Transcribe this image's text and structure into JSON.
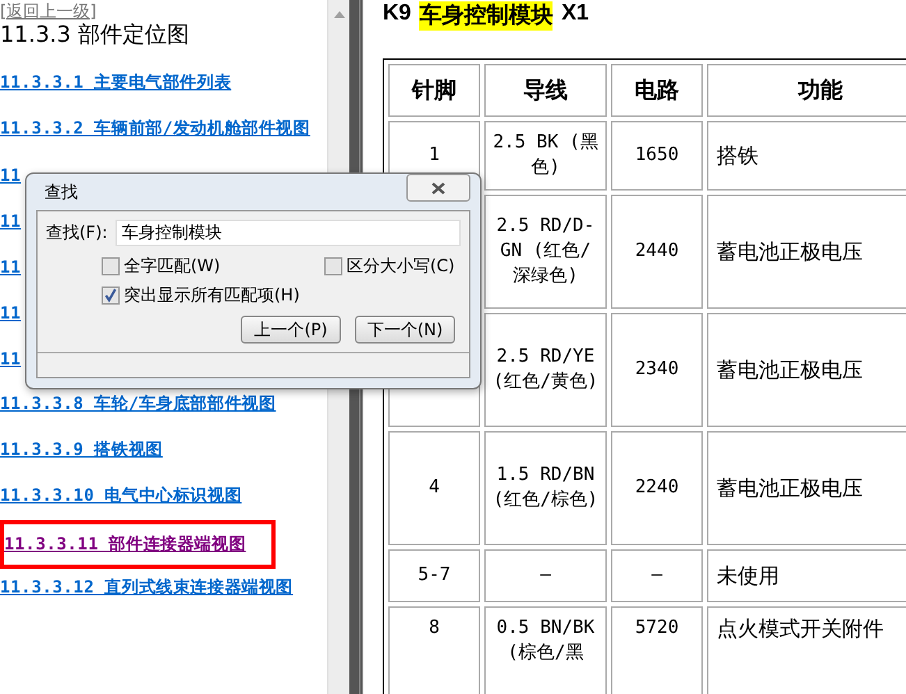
{
  "nav": {
    "back_link": "[返回上一级]",
    "heading": "11.3.3 部件定位图",
    "links": [
      {
        "text": "11.3.3.1 主要电气部件列表",
        "visited": false,
        "highlighted": false
      },
      {
        "text": "11.3.3.2 车辆前部/发动机舱部件视图",
        "visited": false,
        "highlighted": false
      },
      {
        "text": "11",
        "visited": false,
        "highlighted": false
      },
      {
        "text": "11",
        "visited": false,
        "highlighted": false
      },
      {
        "text": "11",
        "visited": false,
        "highlighted": false
      },
      {
        "text": "11",
        "visited": false,
        "highlighted": false
      },
      {
        "text": "11",
        "visited": false,
        "highlighted": false
      },
      {
        "text": "11.3.3.8 车轮/车身底部部件视图",
        "visited": false,
        "highlighted": false
      },
      {
        "text": "11.3.3.9 搭铁视图",
        "visited": false,
        "highlighted": false
      },
      {
        "text": "11.3.3.10 电气中心标识视图",
        "visited": false,
        "highlighted": false
      },
      {
        "text": "11.3.3.11 部件连接器端视图",
        "visited": true,
        "highlighted": true
      },
      {
        "text": "11.3.3.12 直列式线束连接器端视图",
        "visited": false,
        "highlighted": false
      }
    ]
  },
  "content": {
    "title_prefix": "K9",
    "title_match": "车身控制模块",
    "title_suffix": "X1",
    "table": {
      "columns": [
        "针脚",
        "导线",
        "电路",
        "功能"
      ],
      "rows": [
        {
          "pin": "1",
          "wire": "2.5 BK (黑色)",
          "circuit": "1650",
          "function": "搭铁"
        },
        {
          "wire": "2.5 RD/D-GN (红色/深绿色)",
          "circuit": "2440",
          "function": "蓄电池正极电压"
        },
        {
          "wire": "2.5 RD/YE (红色/黄色)",
          "circuit": "2340",
          "function": "蓄电池正极电压"
        },
        {
          "pin": "4",
          "wire": "1.5 RD/BN (红色/棕色)",
          "circuit": "2240",
          "function": "蓄电池正极电压"
        },
        {
          "pin": "5-7",
          "wire": "—",
          "circuit": "—",
          "function": "未使用"
        },
        {
          "pin": "8",
          "wire": "0.5 BN/BK (棕色/黑",
          "circuit": "5720",
          "function": "点火模式开关附件"
        }
      ]
    }
  },
  "find_dialog": {
    "title": "查找",
    "label": "查找(F):",
    "value": "车身控制模块",
    "options": [
      {
        "label": "全字匹配(W)",
        "checked": false
      },
      {
        "label": "区分大小写(C)",
        "checked": false
      },
      {
        "label": "突出显示所有匹配项(H)",
        "checked": true
      }
    ],
    "buttons": [
      "上一个(P)",
      "下一个(N)"
    ]
  }
}
